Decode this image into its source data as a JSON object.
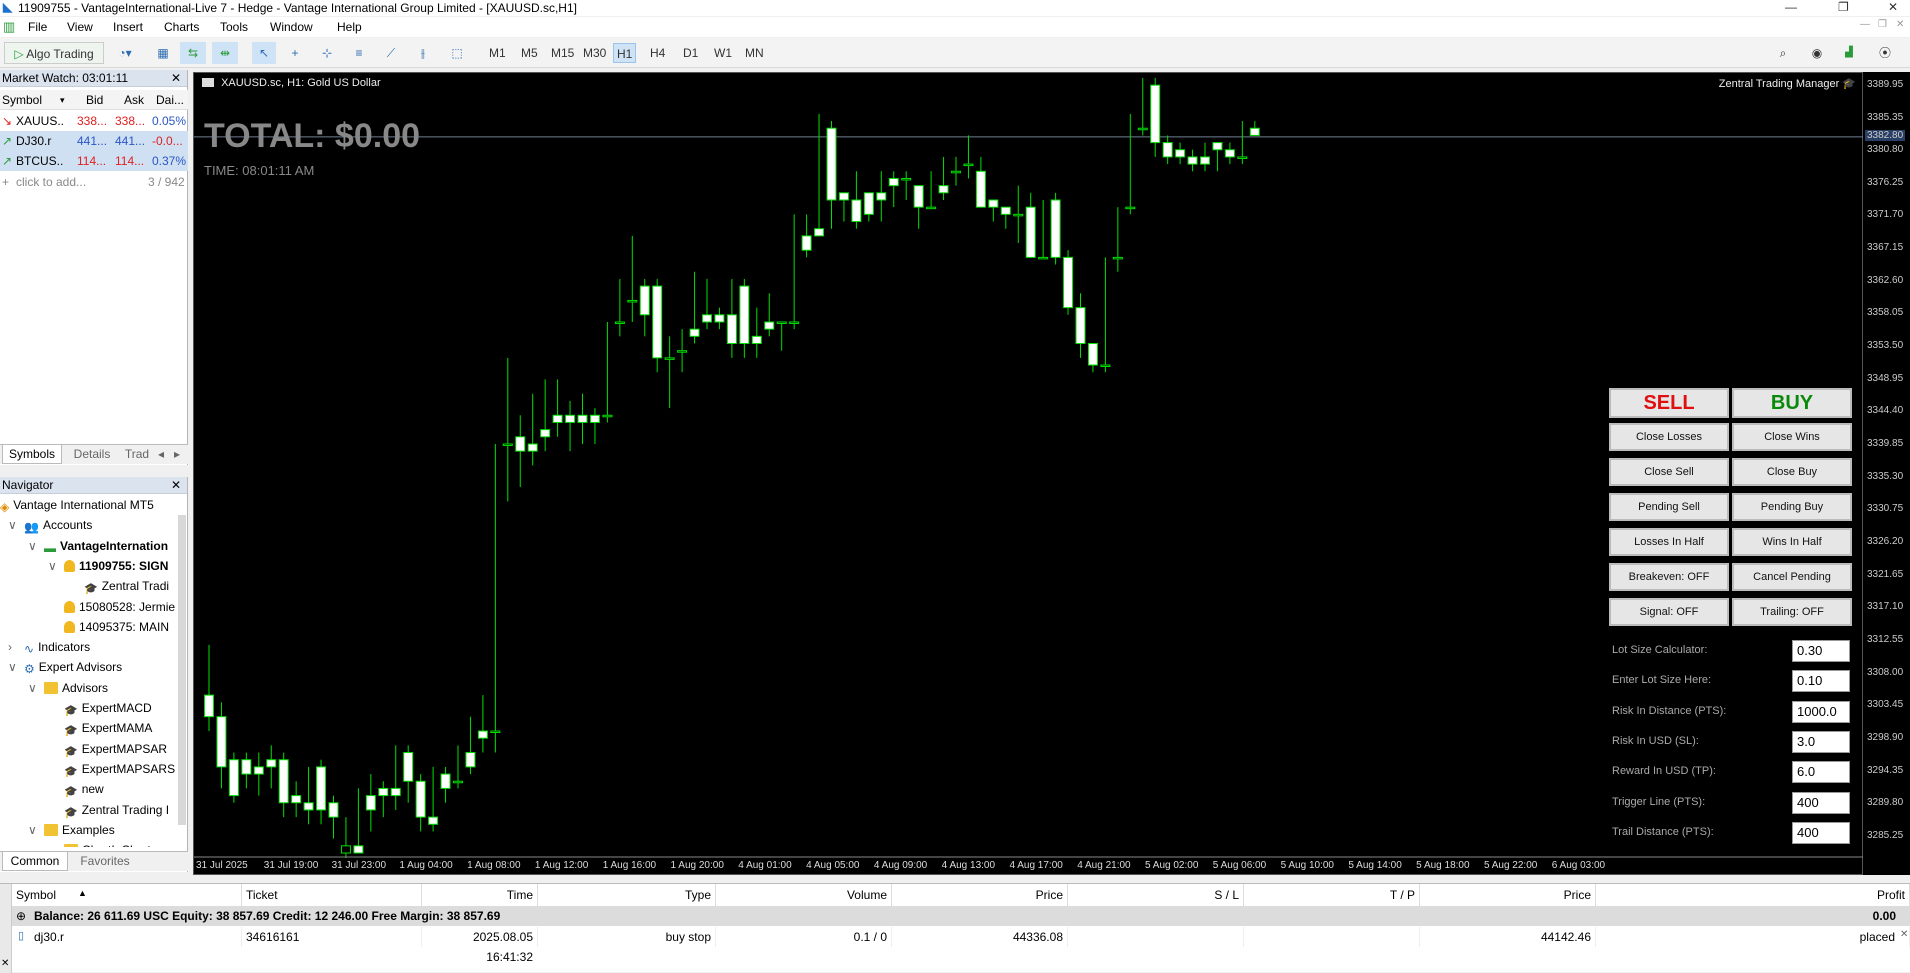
{
  "window": {
    "title": "11909755 - VantageInternational-Live 7 - Hedge - Vantage International Group Limited - [XAUUSD.sc,H1]"
  },
  "menu": [
    "File",
    "View",
    "Insert",
    "Charts",
    "Tools",
    "Window",
    "Help"
  ],
  "toolbar": {
    "algo_label": "Algo Trading",
    "timeframes": [
      "M1",
      "M5",
      "M15",
      "M30",
      "H1",
      "H4",
      "D1",
      "W1",
      "MN"
    ],
    "active_tf": "H1"
  },
  "market_watch": {
    "title": "Market Watch: 03:01:11",
    "columns": [
      "Symbol",
      "Bid",
      "Ask",
      "Dai..."
    ],
    "rows": [
      {
        "symbol": "XAUUS...",
        "bid": "338...",
        "ask": "338...",
        "daily": "0.05%",
        "color": "#e02020"
      },
      {
        "symbol": "DJ30.r",
        "bid": "441...",
        "ask": "441...",
        "daily": "-0.0...",
        "color": "#2a56c6"
      },
      {
        "symbol": "BTCUS...",
        "bid": "114...",
        "ask": "114...",
        "daily": "0.37%",
        "color": "#e02020"
      }
    ],
    "add": "click to add...",
    "count": "3 / 942",
    "tabs": [
      "Symbols",
      "Details",
      "Trad"
    ]
  },
  "navigator": {
    "title": "Navigator",
    "items": [
      {
        "label": "Vantage International MT5",
        "indent": 0,
        "icon": "mt5"
      },
      {
        "label": "Accounts",
        "indent": 1,
        "icon": "accounts"
      },
      {
        "label": "VantageInternation",
        "indent": 2,
        "icon": "server",
        "bold": true
      },
      {
        "label": "11909755: SIGN",
        "indent": 3,
        "icon": "user",
        "bold": true
      },
      {
        "label": "Zentral Tradi",
        "indent": 4,
        "icon": "cap"
      },
      {
        "label": "15080528: Jermie",
        "indent": 3,
        "icon": "user"
      },
      {
        "label": "14095375: MAIN",
        "indent": 3,
        "icon": "user"
      },
      {
        "label": "Indicators",
        "indent": 1,
        "icon": "ind"
      },
      {
        "label": "Expert Advisors",
        "indent": 1,
        "icon": "ea"
      },
      {
        "label": "Advisors",
        "indent": 2,
        "icon": "folder"
      },
      {
        "label": "ExpertMACD",
        "indent": 3,
        "icon": "cap"
      },
      {
        "label": "ExpertMAMA",
        "indent": 3,
        "icon": "cap"
      },
      {
        "label": "ExpertMAPSAR",
        "indent": 3,
        "icon": "cap"
      },
      {
        "label": "ExpertMAPSARS",
        "indent": 3,
        "icon": "cap"
      },
      {
        "label": "new",
        "indent": 3,
        "icon": "cap"
      },
      {
        "label": "Zentral Trading I",
        "indent": 3,
        "icon": "cap"
      },
      {
        "label": "Examples",
        "indent": 2,
        "icon": "folder"
      },
      {
        "label": "ChartInChart",
        "indent": 3,
        "icon": "folder"
      }
    ],
    "tabs": [
      "Common",
      "Favorites"
    ]
  },
  "chart": {
    "header": "XAUUSD.sc, H1:  Gold US Dollar",
    "total": "TOTAL: $0.00",
    "time": "TIME: 08:01:11 AM",
    "ea_name": "Zentral Trading Manager",
    "current_price": "3382.80",
    "price_levels": [
      "3389.95",
      "3385.35",
      "3380.80",
      "3376.25",
      "3371.70",
      "3367.15",
      "3362.60",
      "3358.05",
      "3353.50",
      "3348.95",
      "3344.40",
      "3339.85",
      "3335.30",
      "3330.75",
      "3326.20",
      "3321.65",
      "3317.10",
      "3312.55",
      "3308.00",
      "3303.45",
      "3298.90",
      "3294.35",
      "3289.80",
      "3285.25"
    ],
    "time_labels": [
      "31 Jul 2025",
      "31 Jul 19:00",
      "31 Jul 23:00",
      "1 Aug 04:00",
      "1 Aug 08:00",
      "1 Aug 12:00",
      "1 Aug 16:00",
      "1 Aug 20:00",
      "4 Aug 01:00",
      "4 Aug 05:00",
      "4 Aug 09:00",
      "4 Aug 13:00",
      "4 Aug 17:00",
      "4 Aug 21:00",
      "5 Aug 02:00",
      "5 Aug 06:00",
      "5 Aug 10:00",
      "5 Aug 14:00",
      "5 Aug 18:00",
      "5 Aug 22:00",
      "6 Aug 03:00"
    ]
  },
  "panel": {
    "sell": "SELL",
    "buy": "BUY",
    "buttons": [
      [
        "Close Losses",
        "Close Wins"
      ],
      [
        "Close Sell",
        "Close Buy"
      ],
      [
        "Pending Sell",
        "Pending Buy"
      ],
      [
        "Losses In Half",
        "Wins In Half"
      ],
      [
        "Breakeven: OFF",
        "Cancel Pending"
      ],
      [
        "Signal: OFF",
        "Trailing: OFF"
      ]
    ],
    "fields": [
      {
        "label": "Lot Size Calculator:",
        "value": "0.30"
      },
      {
        "label": "Enter Lot Size Here:",
        "value": "0.10"
      },
      {
        "label": "Risk In Distance (PTS):",
        "value": "1000.0"
      },
      {
        "label": "Risk In USD (SL):",
        "value": "3.0"
      },
      {
        "label": "Reward In USD (TP):",
        "value": "6.0"
      },
      {
        "label": "Trigger Line (PTS):",
        "value": "400"
      },
      {
        "label": "Trail Distance (PTS):",
        "value": "400"
      }
    ]
  },
  "toolbox": {
    "columns": [
      "Symbol",
      "Ticket",
      "Time",
      "Type",
      "Volume",
      "Price",
      "S / L",
      "T / P",
      "Price",
      "Profit"
    ],
    "balance": "Balance: 26 611.69 USC  Equity: 38 857.69  Credit: 12 246.00  Free Margin: 38 857.69",
    "balance_profit": "0.00",
    "order": {
      "symbol": "dj30.r",
      "ticket": "34616161",
      "time": "2025.08.05 16:41:32",
      "type": "buy stop",
      "volume": "0.1 / 0",
      "price": "44336.08",
      "sl": "",
      "tp": "",
      "cur_price": "44142.46",
      "profit": "placed"
    }
  },
  "chart_data": {
    "type": "candlestick",
    "ylim": [
      3283,
      3391
    ],
    "candles": [
      [
        3305,
        3312,
        3302,
        3300
      ],
      [
        3302,
        3304,
        3295,
        3292
      ],
      [
        3296,
        3297,
        3291,
        3290
      ],
      [
        3296,
        3297,
        3294,
        3292
      ],
      [
        3295,
        3297,
        3294,
        3291
      ],
      [
        3296,
        3298,
        3295,
        3292
      ],
      [
        3296,
        3297,
        3290,
        3288
      ],
      [
        3291,
        3293,
        3290,
        3288
      ],
      [
        3290,
        3295,
        3289,
        3287
      ],
      [
        3295,
        3296,
        3289,
        3287
      ],
      [
        3290,
        3291,
        3288,
        3285
      ],
      [
        3283,
        3288,
        3284,
        3281
      ],
      [
        3284,
        3292,
        3283,
        3283
      ],
      [
        3291,
        3294,
        3289,
        3286
      ],
      [
        3292,
        3293,
        3291,
        3288
      ],
      [
        3292,
        3298,
        3291,
        3289
      ],
      [
        3297,
        3298,
        3293,
        3290
      ],
      [
        3293,
        3294,
        3288,
        3286
      ],
      [
        3288,
        3295,
        3287,
        3286
      ],
      [
        3294,
        3295,
        3292,
        3290
      ],
      [
        3293,
        3298,
        3293,
        3292
      ],
      [
        3297,
        3302,
        3295,
        3294
      ],
      [
        3300,
        3305,
        3299,
        3297
      ],
      [
        3300,
        3340,
        3300,
        3297
      ],
      [
        3340,
        3352,
        3340,
        3332
      ],
      [
        3341,
        3344,
        3339,
        3334
      ],
      [
        3340,
        3347,
        3339,
        3337
      ],
      [
        3342,
        3349,
        3341,
        3339
      ],
      [
        3344,
        3349,
        3343,
        3341
      ],
      [
        3344,
        3346,
        3343,
        3339
      ],
      [
        3344,
        3347,
        3343,
        3340
      ],
      [
        3344,
        3345,
        3343,
        3340
      ],
      [
        3344,
        3357,
        3344,
        3343
      ],
      [
        3357,
        3363,
        3357,
        3355
      ],
      [
        3360,
        3369,
        3360,
        3357
      ],
      [
        3362,
        3363,
        3358,
        3355
      ],
      [
        3362,
        3363,
        3352,
        3350
      ],
      [
        3352,
        3355,
        3352,
        3345
      ],
      [
        3353,
        3356,
        3353,
        3350
      ],
      [
        3356,
        3364,
        3355,
        3354
      ],
      [
        3358,
        3363,
        3357,
        3356
      ],
      [
        3358,
        3359,
        3357,
        3356
      ],
      [
        3358,
        3363,
        3354,
        3352
      ],
      [
        3362,
        3363,
        3354,
        3352
      ],
      [
        3355,
        3359,
        3354,
        3352
      ],
      [
        3357,
        3361,
        3356,
        3355
      ],
      [
        3357,
        3357,
        3357,
        3353
      ],
      [
        3357,
        3372,
        3357,
        3356
      ],
      [
        3369,
        3372,
        3367,
        3366
      ],
      [
        3370,
        3386,
        3369,
        3369
      ],
      [
        3384,
        3385,
        3374,
        3370
      ],
      [
        3375,
        3375,
        3374,
        3371
      ],
      [
        3374,
        3378,
        3371,
        3370
      ],
      [
        3375,
        3375,
        3372,
        3371
      ],
      [
        3375,
        3378,
        3374,
        3371
      ],
      [
        3377,
        3378,
        3376,
        3373
      ],
      [
        3377,
        3378,
        3377,
        3374
      ],
      [
        3376,
        3376,
        3373,
        3370
      ],
      [
        3373,
        3378,
        3373,
        3373
      ],
      [
        3376,
        3380,
        3375,
        3374
      ],
      [
        3378,
        3380,
        3378,
        3376
      ],
      [
        3379,
        3383,
        3379,
        3377
      ],
      [
        3378,
        3380,
        3373,
        3373
      ],
      [
        3374,
        3374,
        3373,
        3371
      ],
      [
        3373,
        3373,
        3372,
        3370
      ],
      [
        3372,
        3376,
        3372,
        3368
      ],
      [
        3373,
        3375,
        3366,
        3366
      ],
      [
        3366,
        3374,
        3366,
        3366
      ],
      [
        3374,
        3375,
        3366,
        3365
      ],
      [
        3366,
        3367,
        3359,
        3358
      ],
      [
        3359,
        3361,
        3354,
        3352
      ],
      [
        3354,
        3354,
        3351,
        3350
      ],
      [
        3351,
        3366,
        3351,
        3350
      ],
      [
        3366,
        3373,
        3366,
        3364
      ],
      [
        3373,
        3386,
        3373,
        3372
      ],
      [
        3384,
        3391,
        3384,
        3383
      ],
      [
        3390,
        3391,
        3382,
        3380
      ],
      [
        3382,
        3383,
        3380,
        3379
      ],
      [
        3381,
        3382,
        3380,
        3379
      ],
      [
        3380,
        3381,
        3379,
        3378
      ],
      [
        3380,
        3382,
        3379,
        3378
      ],
      [
        3382,
        3382,
        3381,
        3378
      ],
      [
        3381,
        3382,
        3380,
        3379
      ],
      [
        3380,
        3385,
        3380,
        3379
      ],
      [
        3384,
        3385,
        3383,
        3383
      ]
    ]
  }
}
